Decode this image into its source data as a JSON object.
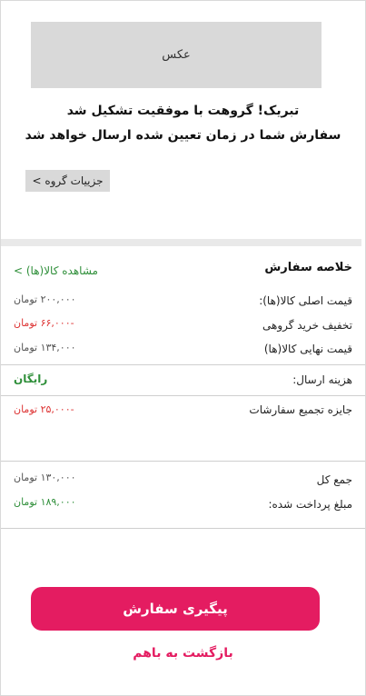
{
  "photo": {
    "label": "عکس"
  },
  "headline": {
    "line1": "تبریک! گروهت با موفقیت تشکیل شد",
    "line2": "سفارش شما در زمان تعیین شده ارسال خواهد شد"
  },
  "group_details_button": "جزییات گروه >",
  "summary": {
    "title": "خلاصه سفارش",
    "view_items_link": "مشاهده کالا(ها) >",
    "rows": [
      {
        "label": "قیمت اصلی کالا(ها):",
        "value": "۲۰۰,۰۰۰ تومان"
      },
      {
        "label": "تخفیف خرید گروهی",
        "value": "-۶۶,۰۰۰ تومان"
      },
      {
        "label": "قیمت نهایی کالا(ها)",
        "value": "۱۳۴,۰۰۰ تومان"
      }
    ],
    "shipping": {
      "label": "هزینه ارسال:",
      "value": "رایگان"
    },
    "reward": {
      "label": "جایزه تجمیع سفارشات",
      "value": "-۲۵,۰۰۰ تومان"
    },
    "total": {
      "label": "جمع کل",
      "value": "۱۳۰,۰۰۰ تومان"
    },
    "paid": {
      "label": "مبلغ پرداخت شده:",
      "value": "۱۸۹,۰۰۰ تومان"
    }
  },
  "actions": {
    "track_order": "پیگیری سفارش",
    "back_to_bahom": "بازگشت به باهم"
  },
  "colors": {
    "accent": "#e41c61",
    "green": "#2f8f3a",
    "red": "#dd3333",
    "placeholder_gray": "#d9d9d9"
  }
}
